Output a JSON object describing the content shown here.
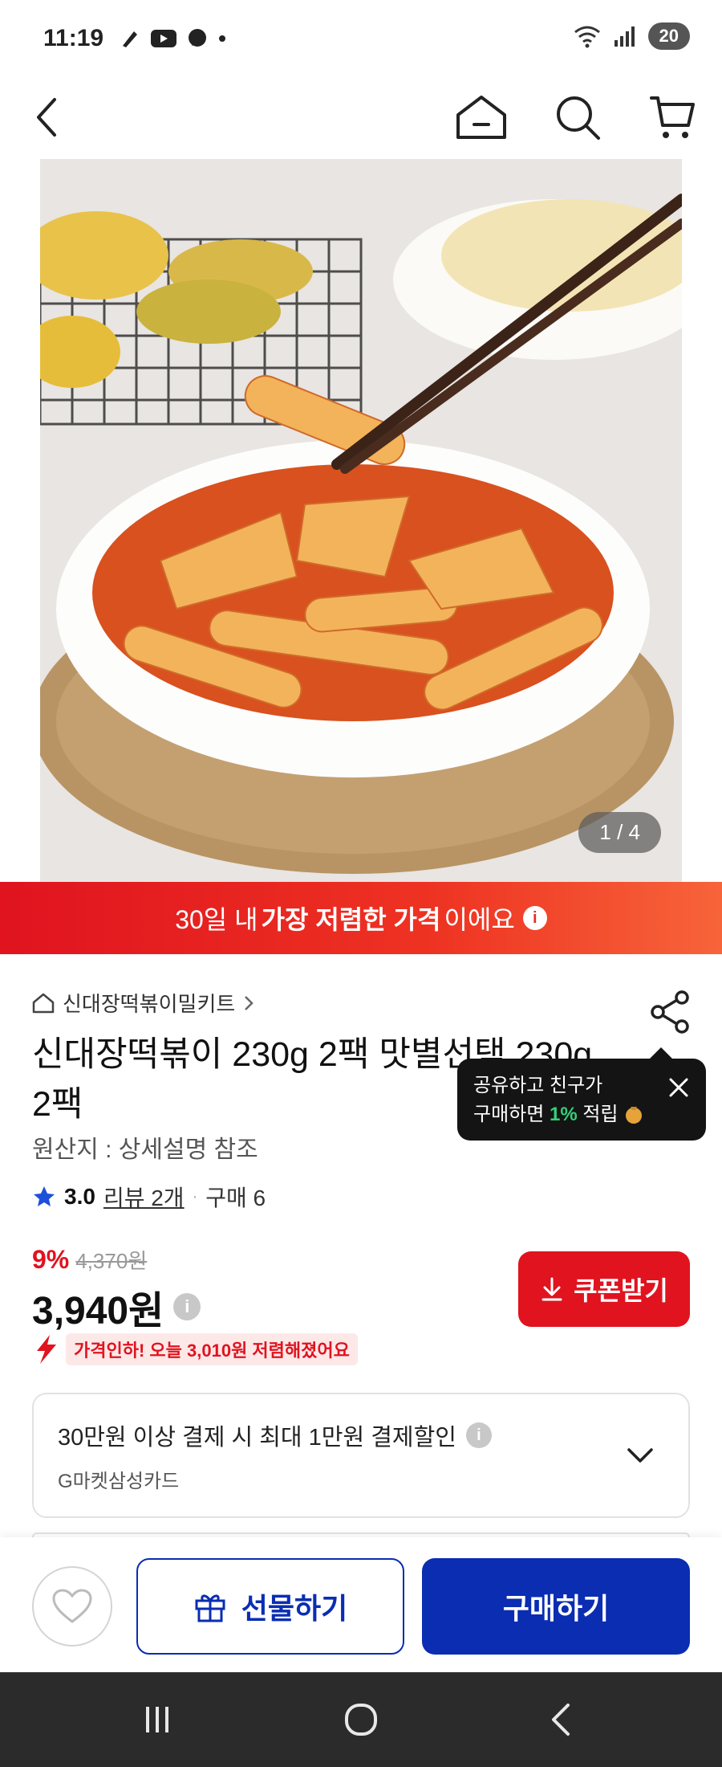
{
  "status_bar": {
    "time": "11:19",
    "battery": "20"
  },
  "hero": {
    "pager": "1 / 4"
  },
  "banner": {
    "prefix": "30일 내 ",
    "highlight": "가장 저렴한 가격",
    "suffix": "이에요"
  },
  "product": {
    "category": "신대장떡볶이밀키트",
    "title": "신대장떡볶이 230g 2팩 맛별선택 230g 2팩",
    "origin": "원산지 : 상세설명 참조",
    "rating": "3.0",
    "review": "리뷰 2개",
    "purchases": "구매 6",
    "discount": "9%",
    "original_price": "4,370원",
    "price": "3,940원",
    "price_drop_label": "가격인하!",
    "price_drop_text": "오늘 3,010원 저렴해졌어요"
  },
  "tooltip": {
    "line1": "공유하고 친구가",
    "line2_pre": "구매하면 ",
    "line2_pct": "1%",
    "line2_post": " 적립"
  },
  "coupon_button": "쿠폰받기",
  "payment": {
    "title": "30만원 이상 결제 시 최대 1만원 결제할인",
    "card": "G마켓삼성카드"
  },
  "actions": {
    "gift": "선물하기",
    "buy": "구매하기"
  },
  "colors": {
    "accent_red": "#e0131f",
    "brand_blue": "#0a2db2",
    "rating_star": "#1f4fd8"
  }
}
